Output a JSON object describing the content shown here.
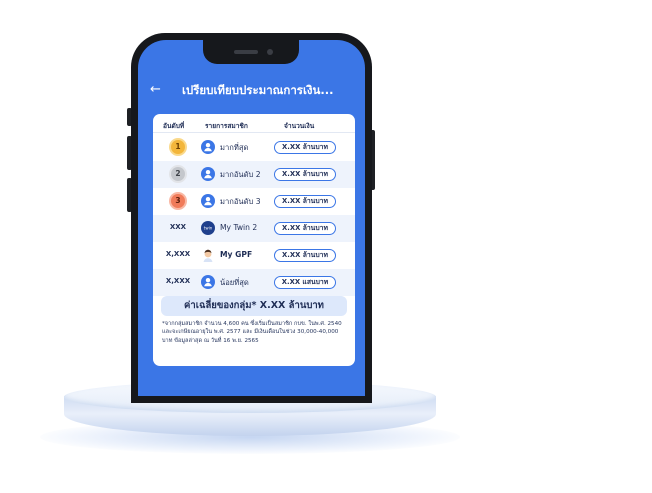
{
  "header": {
    "back_icon": "←",
    "title": "เปรียบเทียบประมาณการเงิน..."
  },
  "table": {
    "headers": [
      "อันดับที่",
      "รายการสมาชิก",
      "จำนวนเงิน"
    ],
    "rows": [
      {
        "rank": "1",
        "rank_style": "gold",
        "avatar_icon": "user-icon",
        "member": "มากที่สุด",
        "amount": "X.XX ล้านบาท"
      },
      {
        "rank": "2",
        "rank_style": "silver",
        "avatar_icon": "user-icon",
        "member": "มากอันดับ 2",
        "amount": "X.XX ล้านบาท"
      },
      {
        "rank": "3",
        "rank_style": "bronze",
        "avatar_icon": "user-icon",
        "member": "มากอันดับ 3",
        "amount": "X.XX ล้านบาท"
      },
      {
        "rank": "XXX",
        "rank_style": "text",
        "avatar_icon": "mytwin-icon",
        "member": "My Twin 2",
        "amount": "X.XX ล้านบาท"
      },
      {
        "rank": "X,XXX",
        "rank_style": "text",
        "avatar_icon": "person-avatar-icon",
        "member": "My GPF",
        "amount": "X.XX ล้านบาท"
      },
      {
        "rank": "X,XXX",
        "rank_style": "text",
        "avatar_icon": "user-icon",
        "member": "น้อยที่สุด",
        "amount": "X.XX แสนบาท"
      }
    ]
  },
  "average_label": "ค่าเฉลี่ยของกลุ่ม* X.XX ล้านบาท",
  "footnote": "*จากกลุ่มสมาชิก จำนวน 4,600 คน ซึ่งเริ่มเป็นสมาชิก กบข. ในพ.ศ. 2540 และจะเกษียณอายุใน พ.ศ. 2577 และ มีเงินเดือนในช่วง 30,000-40,000 บาท ข้อมูลล่าสุด ณ วันที่ 16 พ.ย. 2565",
  "colors": {
    "accent": "#3b76e6",
    "navy": "#1f2d55",
    "gold": "#f3b63b",
    "silver": "#c4c7cc",
    "bronze": "#f07b5a"
  }
}
